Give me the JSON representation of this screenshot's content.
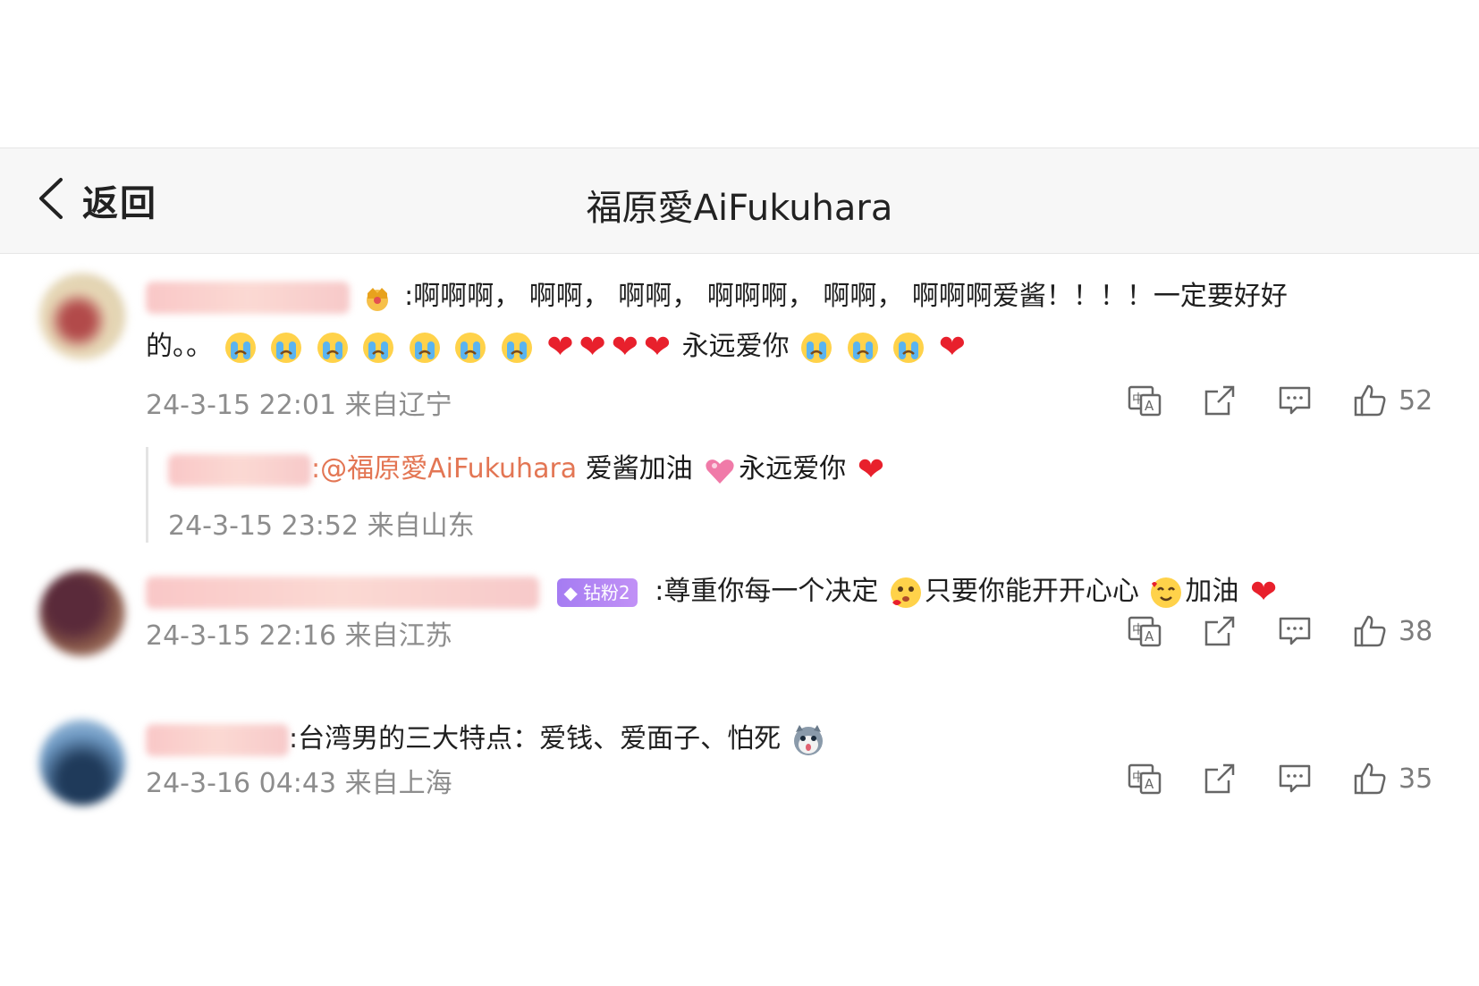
{
  "header": {
    "back_label": "返回",
    "title": "福原愛AiFukuhara"
  },
  "comments": [
    {
      "text_a": ":啊啊啊，  啊啊，  啊啊，  啊啊啊，  啊啊，  啊啊啊爱酱！！！！一定要好好",
      "text_b": "的。。",
      "text_c": "永远爱你",
      "meta": "24-3-15 22:01 来自辽宁",
      "likes": "52"
    },
    {
      "reply_mention": ":@福原愛AiFukuhara",
      "reply_text": " 爱酱加油",
      "reply_text2": "永远爱你",
      "reply_meta": "24-3-15 23:52 来自山东"
    },
    {
      "badge": "钻粉2",
      "text_a": ":尊重你每一个决定",
      "text_b": "只要你能开开心心",
      "text_c": "加油",
      "meta": "24-3-15 22:16 来自江苏",
      "likes": "38"
    },
    {
      "text_a": ":台湾男的三大特点：爱钱、爱面子、怕死",
      "meta": "24-3-16 04:43 来自上海",
      "likes": "35"
    }
  ],
  "icons": {
    "translate": "translate-icon",
    "share": "share-icon",
    "comment": "comment-icon",
    "like": "like-icon"
  }
}
